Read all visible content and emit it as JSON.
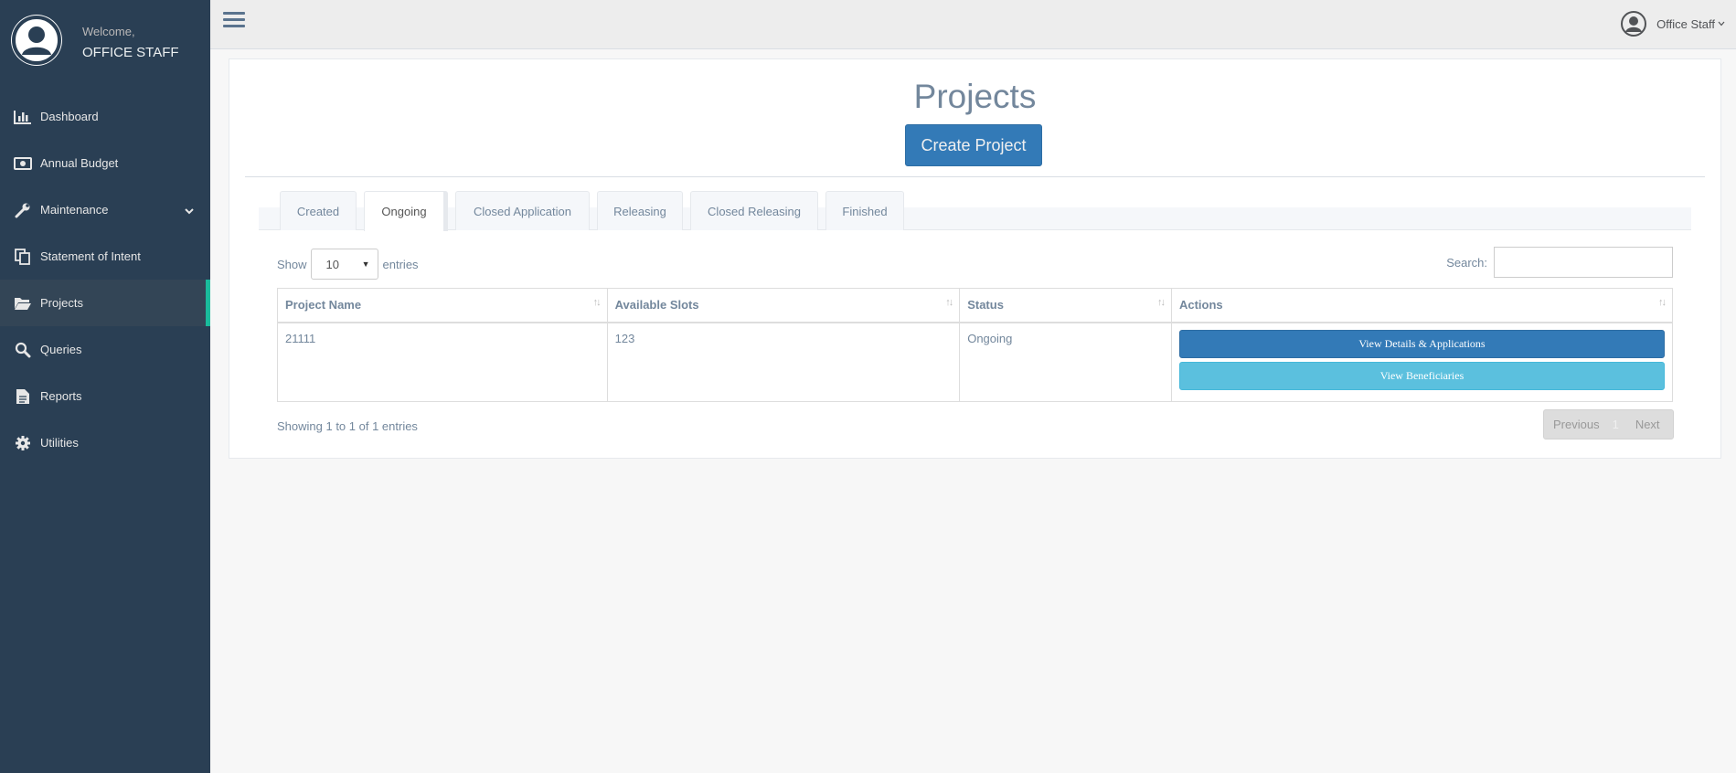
{
  "sidebar": {
    "welcome": "Welcome,",
    "username": "OFFICE STAFF",
    "items": [
      {
        "label": "Dashboard",
        "icon": "bar-chart-icon"
      },
      {
        "label": "Annual Budget",
        "icon": "money-icon"
      },
      {
        "label": "Maintenance",
        "icon": "wrench-icon"
      },
      {
        "label": "Statement of Intent",
        "icon": "copy-icon"
      },
      {
        "label": "Projects",
        "icon": "folder-open-icon"
      },
      {
        "label": "Queries",
        "icon": "search-icon"
      },
      {
        "label": "Reports",
        "icon": "file-text-icon"
      },
      {
        "label": "Utilities",
        "icon": "gear-icon"
      }
    ],
    "active_item": "Projects"
  },
  "topbar": {
    "user_label": "Office Staff"
  },
  "page": {
    "title": "Projects",
    "create_button": "Create Project"
  },
  "tabs": [
    {
      "label": "Created"
    },
    {
      "label": "Ongoing"
    },
    {
      "label": "Closed Application"
    },
    {
      "label": "Releasing"
    },
    {
      "label": "Closed Releasing"
    },
    {
      "label": "Finished"
    }
  ],
  "active_tab": "Ongoing",
  "table_controls": {
    "show_label": "Show",
    "entries_value": "10",
    "entries_label": "entries",
    "search_label": "Search:",
    "search_value": ""
  },
  "table": {
    "headers": [
      "Project Name",
      "Available Slots",
      "Status",
      "Actions"
    ],
    "rows": [
      {
        "project_name": "21111",
        "available_slots": "123",
        "status": "Ongoing",
        "actions": [
          "View Details & Applications",
          "View Beneficiaries"
        ]
      }
    ]
  },
  "footer": {
    "info": "Showing 1 to 1 of 1 entries",
    "previous": "Previous",
    "page": "1",
    "next": "Next"
  },
  "colors": {
    "sidebar_bg": "#2a3f54",
    "active_accent": "#1abb9c",
    "primary": "#337ab7",
    "info": "#5bc0de"
  }
}
